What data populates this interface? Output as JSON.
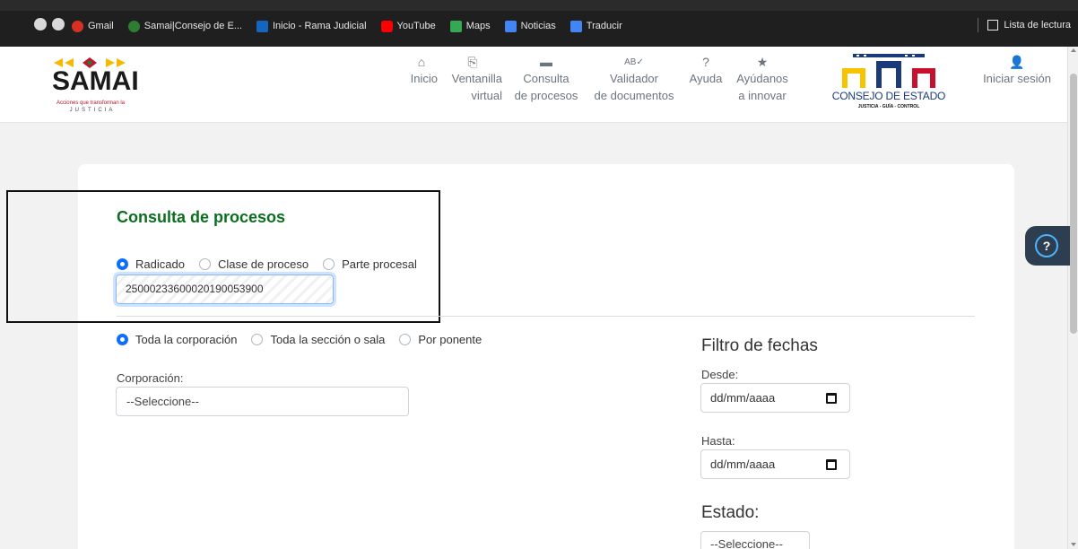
{
  "browser": {
    "bookmarks": [
      {
        "label": "Gmail",
        "icon": "gmail-icon",
        "color": "#d93025"
      },
      {
        "label": "Samai|Consejo de E...",
        "icon": "samai-favicon",
        "color": "#2e7d32"
      },
      {
        "label": "Inicio - Rama Judicial",
        "icon": "rama-judicial-icon",
        "color": "#1565c0"
      },
      {
        "label": "YouTube",
        "icon": "youtube-icon",
        "color": "#ff0000"
      },
      {
        "label": "Maps",
        "icon": "maps-icon",
        "color": "#34a853"
      },
      {
        "label": "Noticias",
        "icon": "news-icon",
        "color": "#4285f4"
      },
      {
        "label": "Traducir",
        "icon": "translate-icon",
        "color": "#4285f4"
      }
    ],
    "reading_list": "Lista de lectura"
  },
  "header": {
    "logo_text": "SAMAI",
    "logo_tagline": "Acciones que transforman la",
    "logo_subtag": "JUSTICIA",
    "nav": [
      {
        "line1": "Inicio",
        "line2": "",
        "icon": "home-icon",
        "glyph": "⌂"
      },
      {
        "line1": "Ventanilla",
        "line2": "virtual",
        "icon": "window-icon",
        "glyph": "⎘"
      },
      {
        "line1": "Consulta",
        "line2": "de procesos",
        "icon": "folder-icon",
        "glyph": "▬"
      },
      {
        "line1": "Validador",
        "line2": "de documentos",
        "icon": "spellcheck-icon",
        "glyph": "ᴬᴮ"
      },
      {
        "line1": "Ayuda",
        "line2": "",
        "icon": "help-circle-icon",
        "glyph": "●"
      },
      {
        "line1": "Ayúdanos",
        "line2": "a innovar",
        "icon": "star-icon",
        "glyph": "★"
      }
    ],
    "consejo_name": "CONSEJO DE ESTADO",
    "consejo_motto": "JUSTICIA - GUÍA - CONTROL",
    "login": "Iniciar sesión"
  },
  "form": {
    "title": "Consulta de procesos",
    "search_modes": [
      "Radicado",
      "Clase de proceso",
      "Parte procesal"
    ],
    "radicado_value": "25000233600020190053900",
    "scope_options": [
      "Toda la corporación",
      "Toda la sección o sala",
      "Por ponente"
    ],
    "corporacion_label": "Corporación:",
    "corporacion_value": "--Seleccione--",
    "date_filter_title": "Filtro de fechas",
    "desde_label": "Desde:",
    "desde_placeholder": "dd/mm/aaaa",
    "hasta_label": "Hasta:",
    "hasta_placeholder": "dd/mm/aaaa",
    "estado_title": "Estado:",
    "estado_value": "--Seleccione--"
  },
  "help_button": "?"
}
